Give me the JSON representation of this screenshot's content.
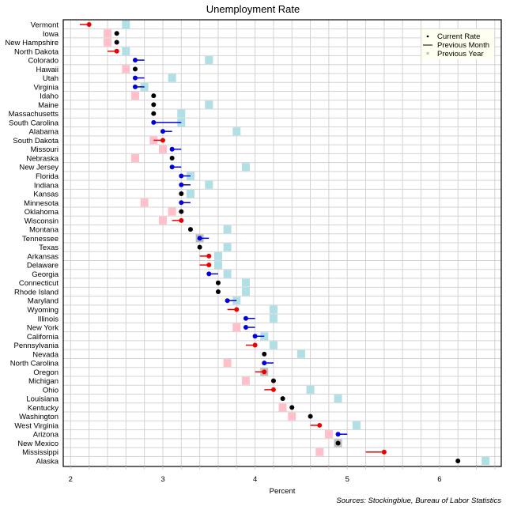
{
  "chart_data": {
    "type": "scatter",
    "title": "Unemployment Rate",
    "xlabel": "Percent",
    "ylabel": "",
    "xlim": [
      1.92,
      6.67
    ],
    "xticks": [
      2,
      3,
      4,
      5,
      6
    ],
    "grid": true,
    "grid_step": 0.2,
    "legend_position": "top-right",
    "legend": [
      {
        "name": "Current Rate",
        "marker": "dot"
      },
      {
        "name": "Previous Month",
        "marker": "line"
      },
      {
        "name": "Previous Year",
        "marker": "square"
      }
    ],
    "colors": {
      "current_unchanged": "#000000",
      "improved": "#0000dd",
      "worsened": "#ee0000",
      "prev_year_higher": "#b0dfe5",
      "prev_year_lower": "#ffc0cb",
      "prev_year_same": "#bebebe",
      "legend_bg": "#fffff0"
    },
    "source": "Sources: Stockingblue, Bureau of Labor Statistics",
    "states": [
      {
        "name": "Vermont",
        "current": 2.2,
        "prev_month": 2.1,
        "prev_year": 2.6
      },
      {
        "name": "Iowa",
        "current": 2.5,
        "prev_month": 2.5,
        "prev_year": 2.4
      },
      {
        "name": "New Hampshire",
        "current": 2.5,
        "prev_month": 2.5,
        "prev_year": 2.4
      },
      {
        "name": "North Dakota",
        "current": 2.5,
        "prev_month": 2.4,
        "prev_year": 2.6
      },
      {
        "name": "Colorado",
        "current": 2.7,
        "prev_month": 2.8,
        "prev_year": 3.5
      },
      {
        "name": "Hawaii",
        "current": 2.7,
        "prev_month": 2.7,
        "prev_year": 2.6
      },
      {
        "name": "Utah",
        "current": 2.7,
        "prev_month": 2.8,
        "prev_year": 3.1
      },
      {
        "name": "Virginia",
        "current": 2.7,
        "prev_month": 2.8,
        "prev_year": 2.8
      },
      {
        "name": "Idaho",
        "current": 2.9,
        "prev_month": 2.9,
        "prev_year": 2.7
      },
      {
        "name": "Maine",
        "current": 2.9,
        "prev_month": 2.9,
        "prev_year": 3.5
      },
      {
        "name": "Massachusetts",
        "current": 2.9,
        "prev_month": 2.9,
        "prev_year": 3.2
      },
      {
        "name": "South Carolina",
        "current": 2.9,
        "prev_month": 3.2,
        "prev_year": 3.2
      },
      {
        "name": "Alabama",
        "current": 3.0,
        "prev_month": 3.1,
        "prev_year": 3.8
      },
      {
        "name": "South Dakota",
        "current": 3.0,
        "prev_month": 2.9,
        "prev_year": 2.9
      },
      {
        "name": "Missouri",
        "current": 3.1,
        "prev_month": 3.2,
        "prev_year": 3.0
      },
      {
        "name": "Nebraska",
        "current": 3.1,
        "prev_month": 3.1,
        "prev_year": 2.7
      },
      {
        "name": "New Jersey",
        "current": 3.1,
        "prev_month": 3.2,
        "prev_year": 3.9
      },
      {
        "name": "Florida",
        "current": 3.2,
        "prev_month": 3.3,
        "prev_year": 3.3
      },
      {
        "name": "Indiana",
        "current": 3.2,
        "prev_month": 3.3,
        "prev_year": 3.5
      },
      {
        "name": "Kansas",
        "current": 3.2,
        "prev_month": 3.2,
        "prev_year": 3.3
      },
      {
        "name": "Minnesota",
        "current": 3.2,
        "prev_month": 3.3,
        "prev_year": 2.8
      },
      {
        "name": "Oklahoma",
        "current": 3.2,
        "prev_month": 3.2,
        "prev_year": 3.1
      },
      {
        "name": "Wisconsin",
        "current": 3.2,
        "prev_month": 3.1,
        "prev_year": 3.0
      },
      {
        "name": "Montana",
        "current": 3.3,
        "prev_month": 3.3,
        "prev_year": 3.7
      },
      {
        "name": "Tennessee",
        "current": 3.4,
        "prev_month": 3.5,
        "prev_year": 3.4
      },
      {
        "name": "Texas",
        "current": 3.4,
        "prev_month": 3.4,
        "prev_year": 3.7
      },
      {
        "name": "Arkansas",
        "current": 3.5,
        "prev_month": 3.4,
        "prev_year": 3.6
      },
      {
        "name": "Delaware",
        "current": 3.5,
        "prev_month": 3.4,
        "prev_year": 3.6
      },
      {
        "name": "Georgia",
        "current": 3.5,
        "prev_month": 3.6,
        "prev_year": 3.7
      },
      {
        "name": "Connecticut",
        "current": 3.6,
        "prev_month": 3.6,
        "prev_year": 3.9
      },
      {
        "name": "Rhode Island",
        "current": 3.6,
        "prev_month": 3.6,
        "prev_year": 3.9
      },
      {
        "name": "Maryland",
        "current": 3.7,
        "prev_month": 3.8,
        "prev_year": 3.8
      },
      {
        "name": "Wyoming",
        "current": 3.8,
        "prev_month": 3.7,
        "prev_year": 4.2
      },
      {
        "name": "Illinois",
        "current": 3.9,
        "prev_month": 4.0,
        "prev_year": 4.2
      },
      {
        "name": "New York",
        "current": 3.9,
        "prev_month": 4.0,
        "prev_year": 3.8
      },
      {
        "name": "California",
        "current": 4.0,
        "prev_month": 4.1,
        "prev_year": 4.1
      },
      {
        "name": "Pennsylvania",
        "current": 4.0,
        "prev_month": 3.9,
        "prev_year": 4.2
      },
      {
        "name": "Nevada",
        "current": 4.1,
        "prev_month": 4.1,
        "prev_year": 4.5
      },
      {
        "name": "North Carolina",
        "current": 4.1,
        "prev_month": 4.2,
        "prev_year": 3.7
      },
      {
        "name": "Oregon",
        "current": 4.1,
        "prev_month": 4.0,
        "prev_year": 4.1
      },
      {
        "name": "Michigan",
        "current": 4.2,
        "prev_month": 4.2,
        "prev_year": 3.9
      },
      {
        "name": "Ohio",
        "current": 4.2,
        "prev_month": 4.1,
        "prev_year": 4.6
      },
      {
        "name": "Louisiana",
        "current": 4.3,
        "prev_month": 4.3,
        "prev_year": 4.9
      },
      {
        "name": "Kentucky",
        "current": 4.4,
        "prev_month": 4.4,
        "prev_year": 4.3
      },
      {
        "name": "Washington",
        "current": 4.6,
        "prev_month": 4.6,
        "prev_year": 4.4
      },
      {
        "name": "West Virginia",
        "current": 4.7,
        "prev_month": 4.6,
        "prev_year": 5.1
      },
      {
        "name": "Arizona",
        "current": 4.9,
        "prev_month": 5.0,
        "prev_year": 4.8
      },
      {
        "name": "New Mexico",
        "current": 4.9,
        "prev_month": 4.9,
        "prev_year": 4.9
      },
      {
        "name": "Mississippi",
        "current": 5.4,
        "prev_month": 5.2,
        "prev_year": 4.7
      },
      {
        "name": "Alaska",
        "current": 6.2,
        "prev_month": 6.2,
        "prev_year": 6.5
      }
    ]
  }
}
